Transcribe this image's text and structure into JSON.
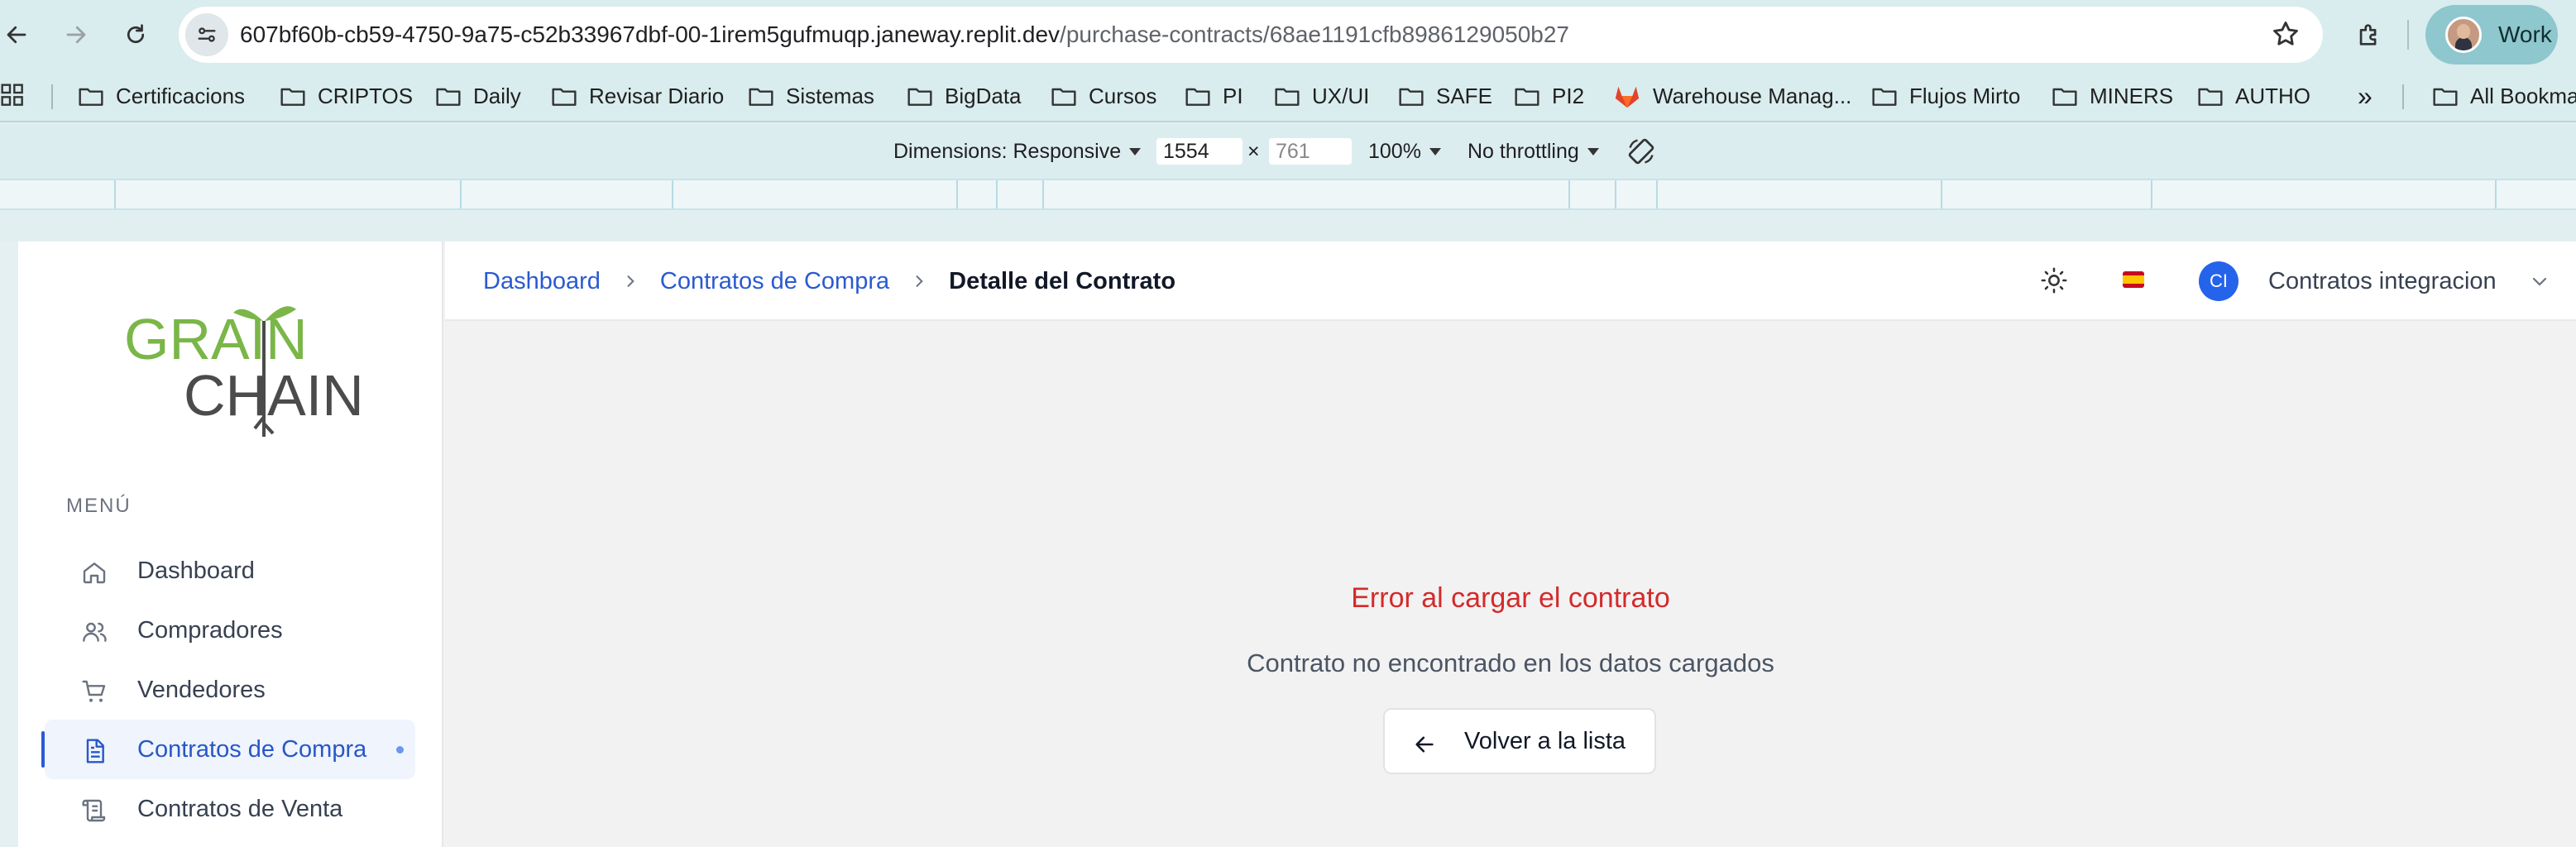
{
  "browser": {
    "url_host": "607bf60b-cb59-4750-9a75-c52b33967dbf-00-1irem5gufmuqp.janeway.replit.dev",
    "url_path": "/purchase-contracts/68ae1191cfb8986129050b27",
    "profile_label": "Work"
  },
  "bookmarks": {
    "items": [
      "Certificacions",
      "CRIPTOS",
      "Daily",
      "Revisar Diario",
      "Sistemas",
      "BigData",
      "Cursos",
      "PI",
      "UX/UI",
      "SAFE",
      "PI2",
      "Warehouse Manag...",
      "Flujos Mirto",
      "MINERS",
      "AUTHO"
    ],
    "overflow": "»",
    "all_bookmarks": "All Bookma"
  },
  "devtools": {
    "dimensions_label": "Dimensions: Responsive",
    "width": "1554",
    "x": "×",
    "height": "761",
    "zoom": "100%",
    "throttling": "No throttling"
  },
  "app": {
    "logo_top": "GRAIN",
    "logo_bottom": "CHAIN",
    "menu_label": "MENÚ",
    "sidebar": [
      {
        "label": "Dashboard",
        "icon": "home-icon"
      },
      {
        "label": "Compradores",
        "icon": "users-icon"
      },
      {
        "label": "Vendedores",
        "icon": "cart-icon"
      },
      {
        "label": "Contratos de Compra",
        "icon": "document-icon",
        "active": true
      },
      {
        "label": "Contratos de Venta",
        "icon": "scroll-icon"
      }
    ],
    "breadcrumb": [
      "Dashboard",
      "Contratos de Compra",
      "Detalle del Contrato"
    ],
    "user_initials": "CI",
    "user_name": "Contratos integracion",
    "error_title": "Error al cargar el contrato",
    "error_message": "Contrato no encontrado en los datos cargados",
    "back_button": "Volver a la lista"
  },
  "colors": {
    "accent": "#2a5ad2",
    "error": "#d42a2a",
    "logo_green": "#7ab648",
    "logo_gray": "#4b4b4b"
  }
}
